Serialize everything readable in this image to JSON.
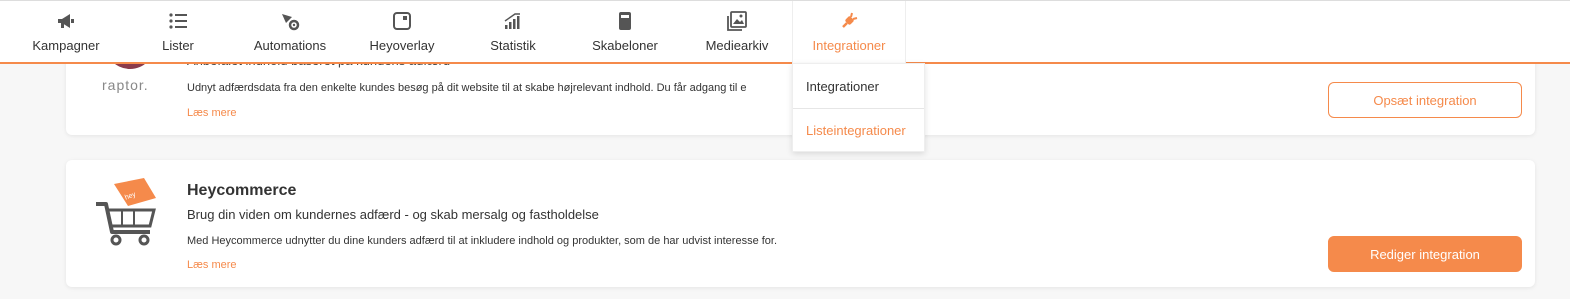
{
  "nav": {
    "items": [
      {
        "label": "Kampagner",
        "icon": "megaphone-icon"
      },
      {
        "label": "Lister",
        "icon": "list-icon"
      },
      {
        "label": "Automations",
        "icon": "automation-gear-icon"
      },
      {
        "label": "Heyoverlay",
        "icon": "overlay-icon"
      },
      {
        "label": "Statistik",
        "icon": "bar-chart-icon"
      },
      {
        "label": "Skabeloner",
        "icon": "template-icon"
      },
      {
        "label": "Mediearkiv",
        "icon": "image-icon"
      },
      {
        "label": "Integrationer",
        "icon": "plug-icon",
        "active": true
      }
    ],
    "accent_color": "#f58a4b"
  },
  "dropdown": {
    "items": [
      {
        "label": "Integrationer"
      },
      {
        "label": "Listeintegrationer"
      }
    ]
  },
  "cards": [
    {
      "logo_text": "raptor.",
      "title_partial": "Anbefalet indhold baseret på kundens adfærd",
      "description": "Udnyt adfærdsdata fra den enkelte kundes besøg på dit website til at skabe højrelevant indhold. Du får adgang til e",
      "link": "Læs mere",
      "button": "Opsæt integration"
    },
    {
      "logo_text": "Heycommerce",
      "title": "Heycommerce",
      "subtitle": "Brug din viden om kundernes adfærd - og skab mersalg og fastholdelse",
      "description": "Med Heycommerce udnytter du dine kunders adfærd til at inkludere indhold og produkter, som de har udvist interesse for.",
      "link": "Læs mere",
      "button": "Rediger integration"
    }
  ]
}
